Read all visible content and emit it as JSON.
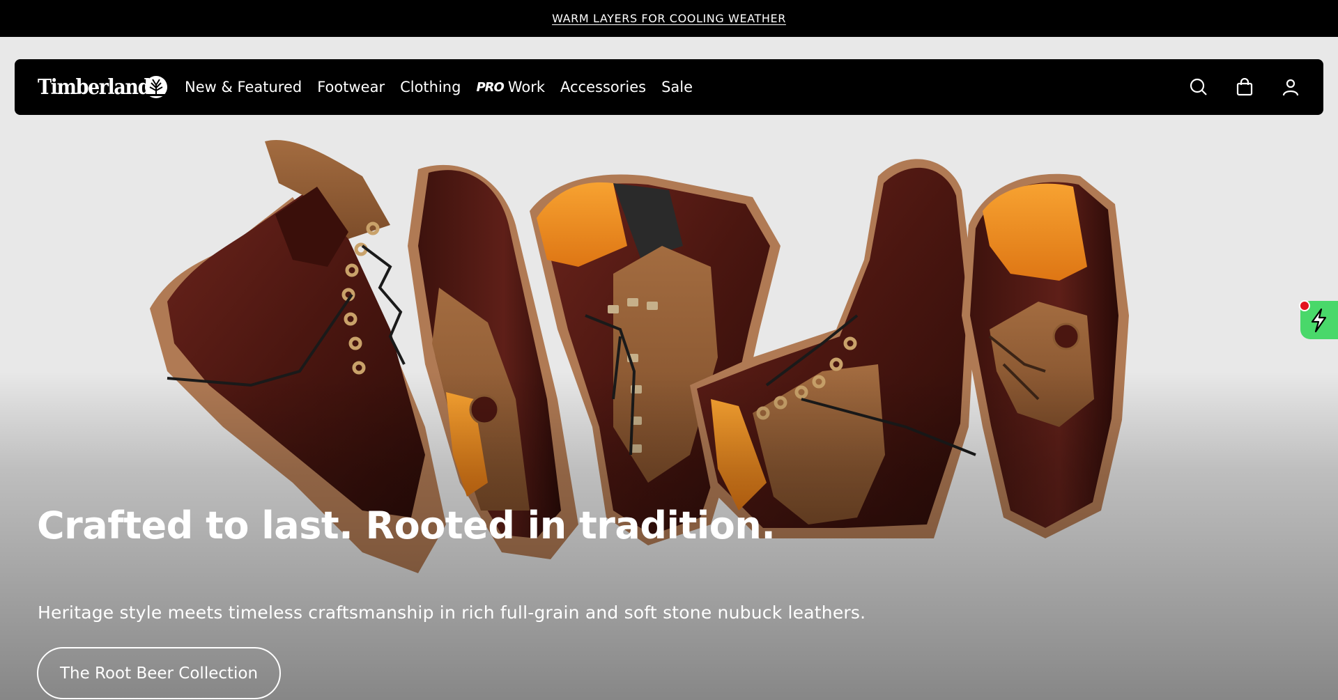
{
  "promo": {
    "text": "WARM LAYERS FOR COOLING WEATHER"
  },
  "nav": {
    "logo_text": "Timberland",
    "links": [
      {
        "label": "New & Featured"
      },
      {
        "label": "Footwear"
      },
      {
        "label": "Clothing"
      },
      {
        "label": "Work",
        "badge": "PRO"
      },
      {
        "label": "Accessories"
      },
      {
        "label": "Sale"
      }
    ],
    "icons": [
      "search-icon",
      "shopping-bag-icon",
      "account-icon"
    ]
  },
  "hero": {
    "title": "Crafted to last. Rooted in tradition.",
    "subtitle": "Heritage style meets timeless craftsmanship in rich full-grain and soft stone nubuck leathers.",
    "cta": "The Root Beer Collection"
  },
  "extension": {
    "icon": "lightning-icon"
  },
  "colors": {
    "bar": "#000000",
    "leather": "#4a1a14",
    "nubuck": "#9a6438",
    "sole": "#b07a54",
    "lining": "#f08a1e",
    "extension_green": "#49d86a"
  }
}
